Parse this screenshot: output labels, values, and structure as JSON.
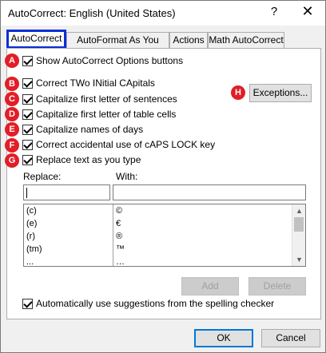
{
  "window": {
    "title": "AutoCorrect: English (United States)",
    "help_glyph": "?",
    "close_glyph": "✕"
  },
  "tabs": [
    {
      "label": "AutoCorrect",
      "active": true
    },
    {
      "label": "AutoFormat As You Type",
      "active": false
    },
    {
      "label": "Actions",
      "active": false
    },
    {
      "label": "Math AutoCorrect",
      "active": false
    }
  ],
  "badges": [
    "A",
    "B",
    "C",
    "D",
    "E",
    "F",
    "G",
    "H"
  ],
  "options": {
    "show_buttons": "Show AutoCorrect Options buttons",
    "two_initial_caps": "Correct TWo INitial CApitals",
    "capitalize_sentences": "Capitalize first letter of sentences",
    "capitalize_table_cells": "Capitalize first letter of table cells",
    "capitalize_days": "Capitalize names of days",
    "caps_lock": "Correct accidental use of cAPS LOCK key",
    "replace_as_type": "Replace text as you type",
    "spelling_suggestions": "Automatically use suggestions from the spelling checker"
  },
  "exceptions_button": "Exceptions...",
  "replace_label": "Replace:",
  "with_label": "With:",
  "replace_value": "",
  "with_value": "",
  "replacements": [
    {
      "replace": "(c)",
      "with": "©"
    },
    {
      "replace": "(e)",
      "with": "€"
    },
    {
      "replace": "(r)",
      "with": "®"
    },
    {
      "replace": "(tm)",
      "with": "™"
    },
    {
      "replace": "...",
      "with": "…"
    }
  ],
  "add_button": "Add",
  "delete_button": "Delete",
  "ok_button": "OK",
  "cancel_button": "Cancel",
  "colors": {
    "badge": "#e21e26",
    "active_tab_border": "#0b2ed6",
    "default_button_border": "#0078d7"
  }
}
